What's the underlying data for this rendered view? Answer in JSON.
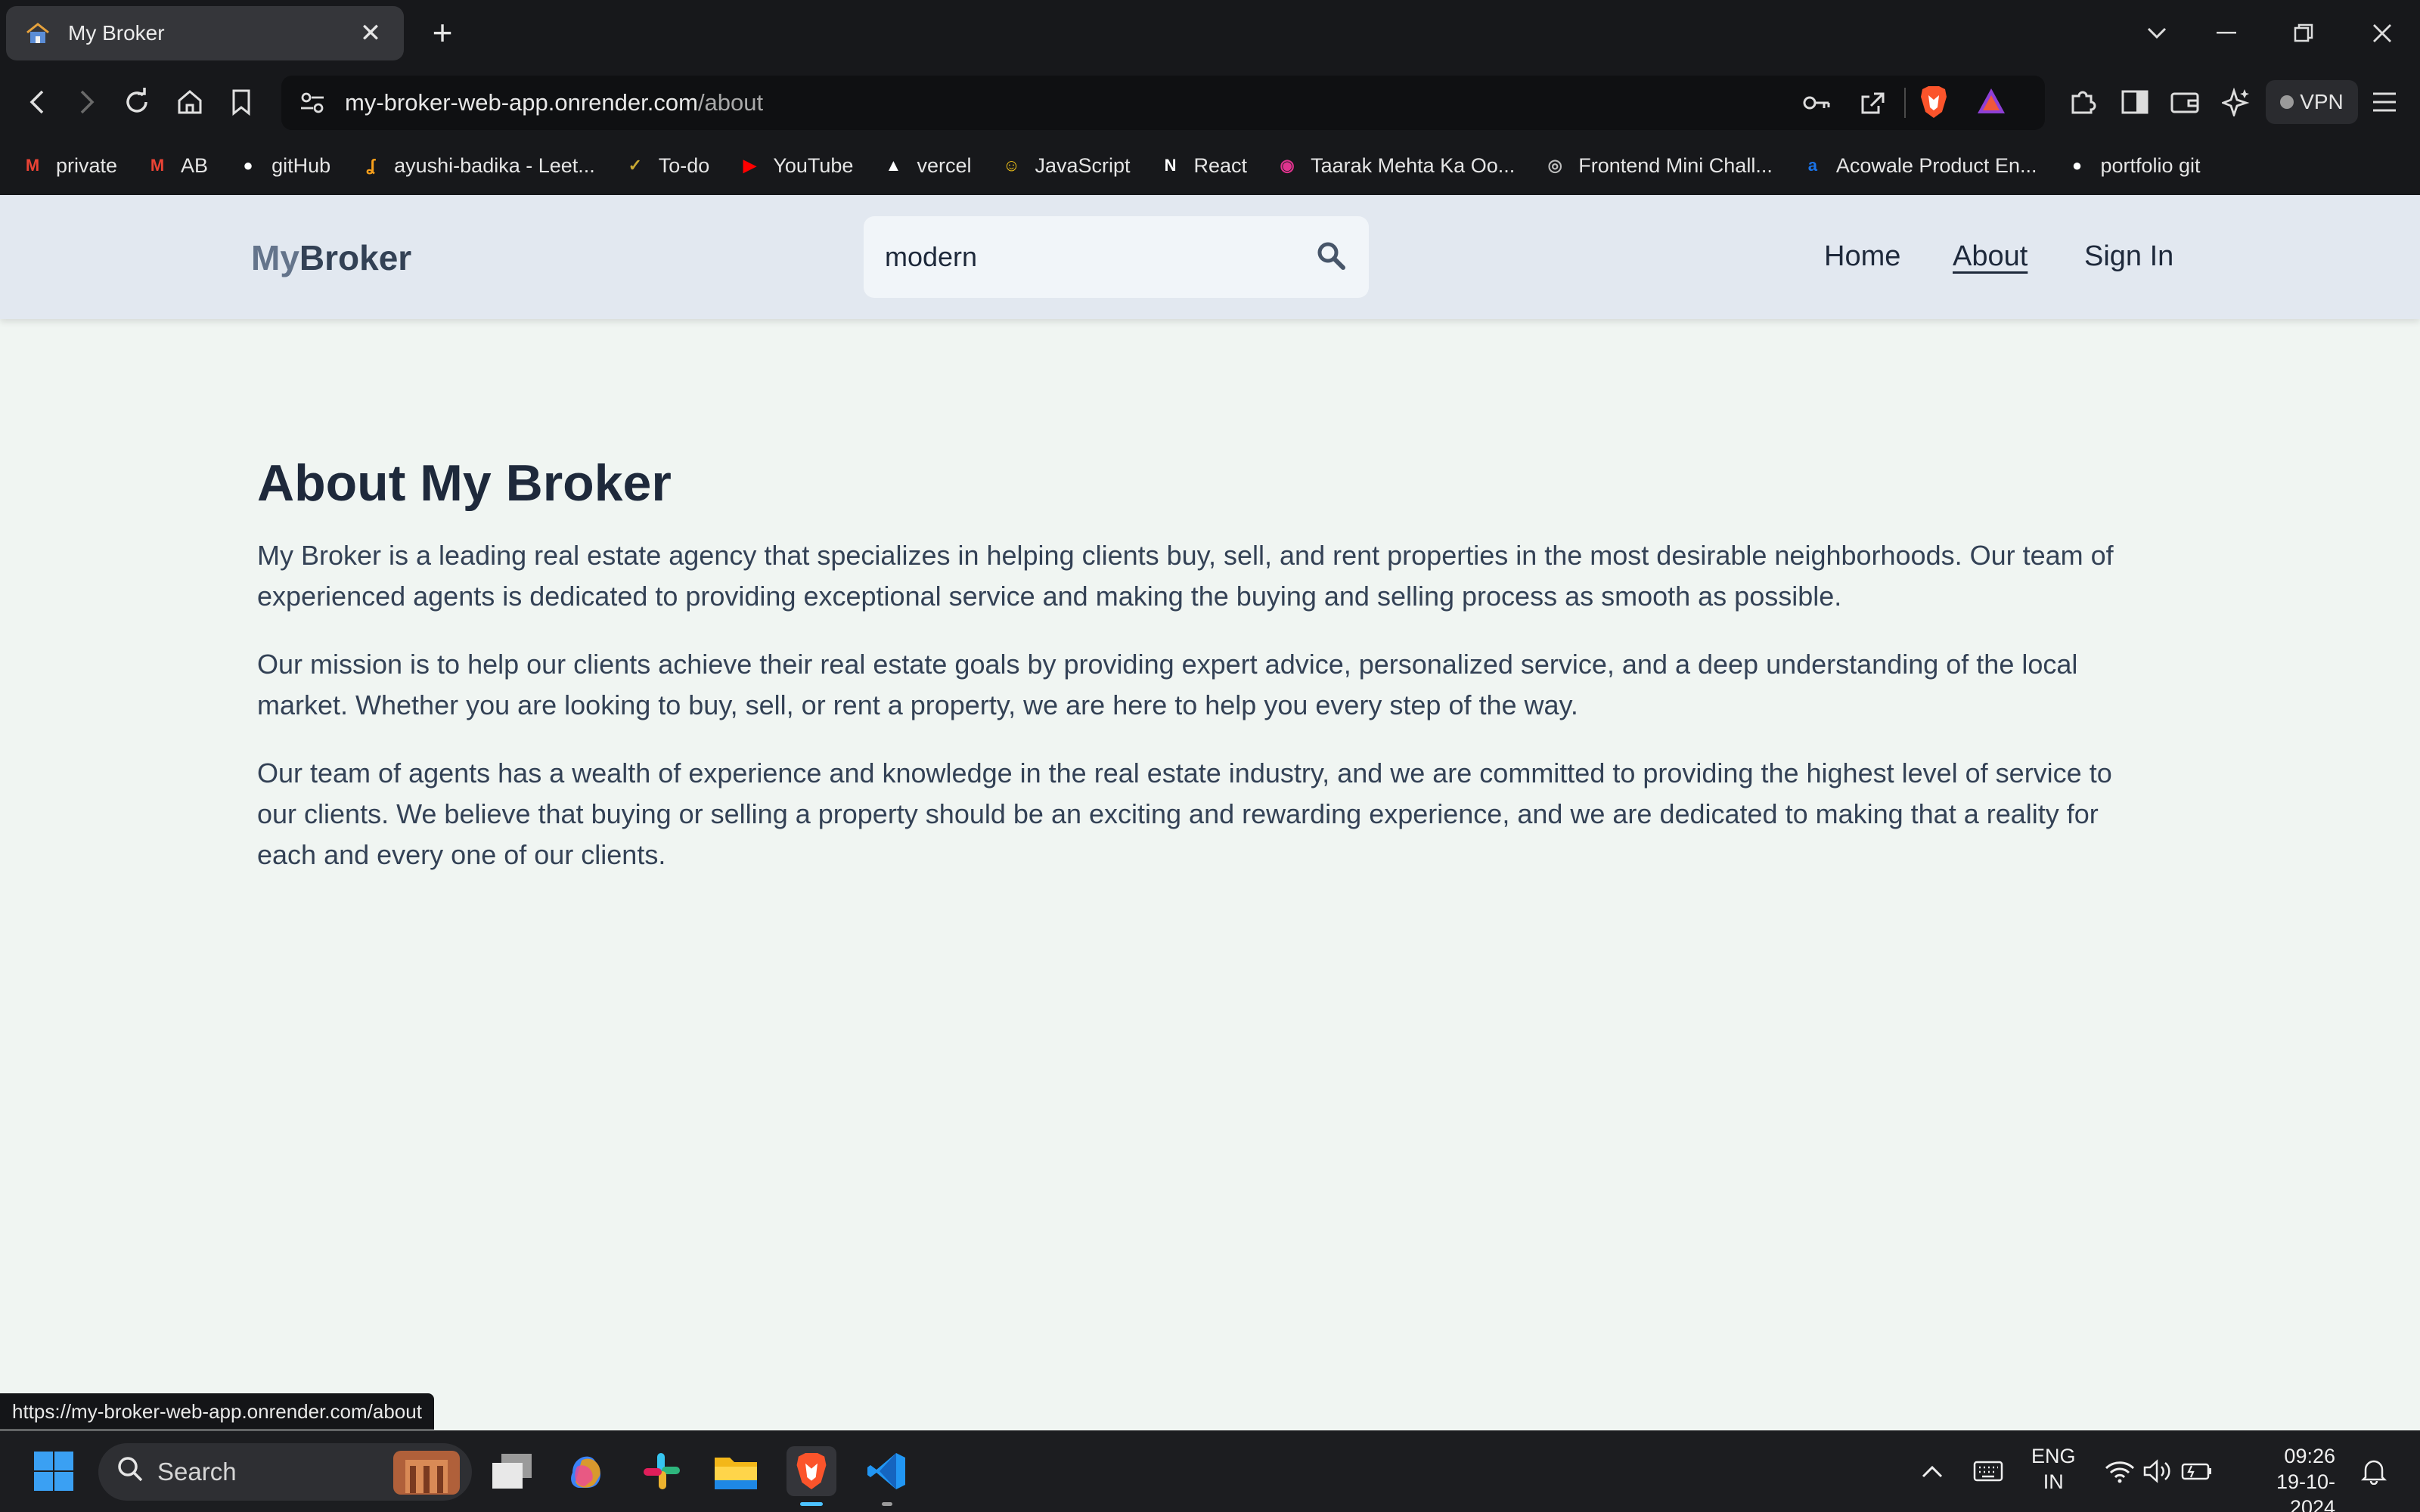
{
  "browser": {
    "tab_title": "My Broker",
    "url_domain": "my-broker-web-app.onrender.com",
    "url_path": "/about",
    "vpn_label": "VPN",
    "bookmarks": [
      {
        "label": "private",
        "icon": "gmail-icon",
        "color": "#ea4335"
      },
      {
        "label": "AB",
        "icon": "gmail-icon",
        "color": "#ea4335"
      },
      {
        "label": "gitHub",
        "icon": "github-icon",
        "color": "#ffffff"
      },
      {
        "label": "ayushi-badika - Leet...",
        "icon": "leetcode-icon",
        "color": "#f89f1b"
      },
      {
        "label": "To-do",
        "icon": "todo-icon",
        "color": "#c8a832"
      },
      {
        "label": "YouTube",
        "icon": "youtube-icon",
        "color": "#ff0000"
      },
      {
        "label": "vercel",
        "icon": "vercel-icon",
        "color": "#ffffff"
      },
      {
        "label": "JavaScript",
        "icon": "emoji-icon",
        "color": "#f5c518"
      },
      {
        "label": "React",
        "icon": "notion-icon",
        "color": "#ffffff"
      },
      {
        "label": "Taarak Mehta Ka Oo...",
        "icon": "sonyliv-icon",
        "color": "#e0338e"
      },
      {
        "label": "Frontend Mini Chall...",
        "icon": "frontend-icon",
        "color": "#bdbdbd"
      },
      {
        "label": "Acowale Product En...",
        "icon": "acowale-icon",
        "color": "#1a73e8"
      },
      {
        "label": "portfolio git",
        "icon": "github-icon",
        "color": "#ffffff"
      }
    ],
    "status_url": "https://my-broker-web-app.onrender.com/about"
  },
  "site": {
    "logo_part1": "My",
    "logo_part2": "Broker",
    "search_value": "modern",
    "nav": {
      "home": "Home",
      "about": "About",
      "signin": "Sign In"
    }
  },
  "about": {
    "heading": "About My Broker",
    "paragraphs": [
      "My Broker is a leading real estate agency that specializes in helping clients buy, sell, and rent properties in the most desirable neighborhoods. Our team of experienced agents is dedicated to providing exceptional service and making the buying and selling process as smooth as possible.",
      "Our mission is to help our clients achieve their real estate goals by providing expert advice, personalized service, and a deep understanding of the local market. Whether you are looking to buy, sell, or rent a property, we are here to help you every step of the way.",
      "Our team of agents has a wealth of experience and knowledge in the real estate industry, and we are committed to providing the highest level of service to our clients. We believe that buying or selling a property should be an exciting and rewarding experience, and we are dedicated to making that a reality for each and every one of our clients."
    ]
  },
  "taskbar": {
    "search_label": "Search",
    "lang_top": "ENG",
    "lang_bottom": "IN",
    "time": "09:26",
    "date": "19-10-2024"
  },
  "colors": {
    "accent_brave": "#fb542b",
    "page_bg": "#f0f5f2",
    "header_bg": "#e2e8f0"
  }
}
